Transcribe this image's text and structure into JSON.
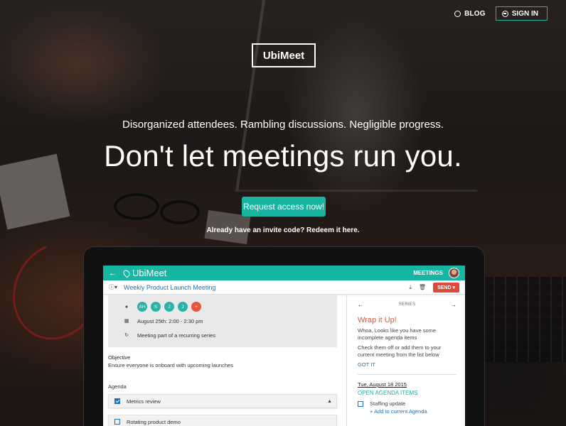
{
  "nav": {
    "blog_label": "BLOG",
    "signin_label": "SIGN IN"
  },
  "brand": {
    "logo_text": "UbiMeet"
  },
  "hero": {
    "subtitle": "Disorganized attendees. Rambling discussions. Negligible progress.",
    "headline": "Don't let meetings run you.",
    "cta_label": "Request access now!",
    "invite_text": "Already have an invite code? Redeem it here."
  },
  "app": {
    "title": "UbiMeet",
    "meetings_label": "MEETINGS",
    "meeting_title": "Weekly Product Launch Meeting",
    "send_label": "SEND ▾",
    "attendees": [
      "AH",
      "S",
      "J",
      "J",
      "+"
    ],
    "date_text": "August 25th: 2:00 - 2:30 pm",
    "recurring_text": "Meeting part of a recurring series",
    "objective_label": "Objective",
    "objective_text": "Ensure everyone is onboard with upcoming launches",
    "agenda_label": "Agenda",
    "agenda_items": [
      {
        "label": "Metrics review",
        "checked": true
      },
      {
        "label": "Rotating product demo",
        "checked": false
      }
    ],
    "series_label": "SERIES",
    "wrap_title": "Wrap it Up!",
    "wrap_text_1": "Whoa, Looks like you have some incomplete agenda items",
    "wrap_text_2": "Check them off or add them to your current meeting from the list below",
    "got_it": "GOT IT",
    "past_date": "Tue, August 18 2015",
    "open_items_label": "OPEN AGENDA ITEMS",
    "open_item": "Staffing update",
    "add_to_agenda": "+ Add to current Agenda"
  },
  "colors": {
    "accent": "#17b5a0",
    "send": "#e04a3a",
    "link": "#1d73b8",
    "wrap": "#e0553e"
  }
}
